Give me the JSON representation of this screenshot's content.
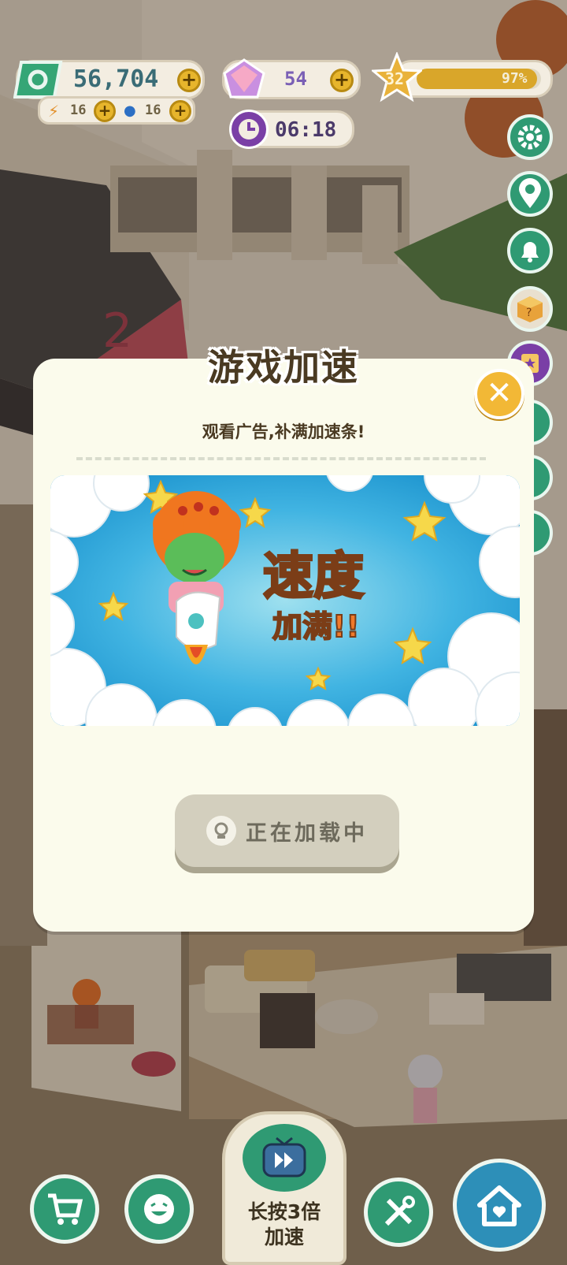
{
  "hud": {
    "money": "56,704",
    "energy": "16",
    "water": "16",
    "gems": "54",
    "level": "32",
    "xp_percent_label": "97%",
    "xp_fraction": 0.97,
    "timer": "06:18"
  },
  "modal": {
    "title": "游戏加速",
    "subtitle": "观看广告,补满加速条!",
    "banner_text_line1": "速度",
    "banner_text_line2": "加满!!",
    "loading_label": "正在加载中"
  },
  "bottom_bar": {
    "speed_label_line1": "长按3倍",
    "speed_label_line2": "加速"
  },
  "scene": {
    "floor_sign": "2"
  },
  "colors": {
    "accent_green": "#2f9a73",
    "gold": "#f2b836",
    "modal_bg": "#fbfbec",
    "banner_sky": "#2fa6d8"
  }
}
